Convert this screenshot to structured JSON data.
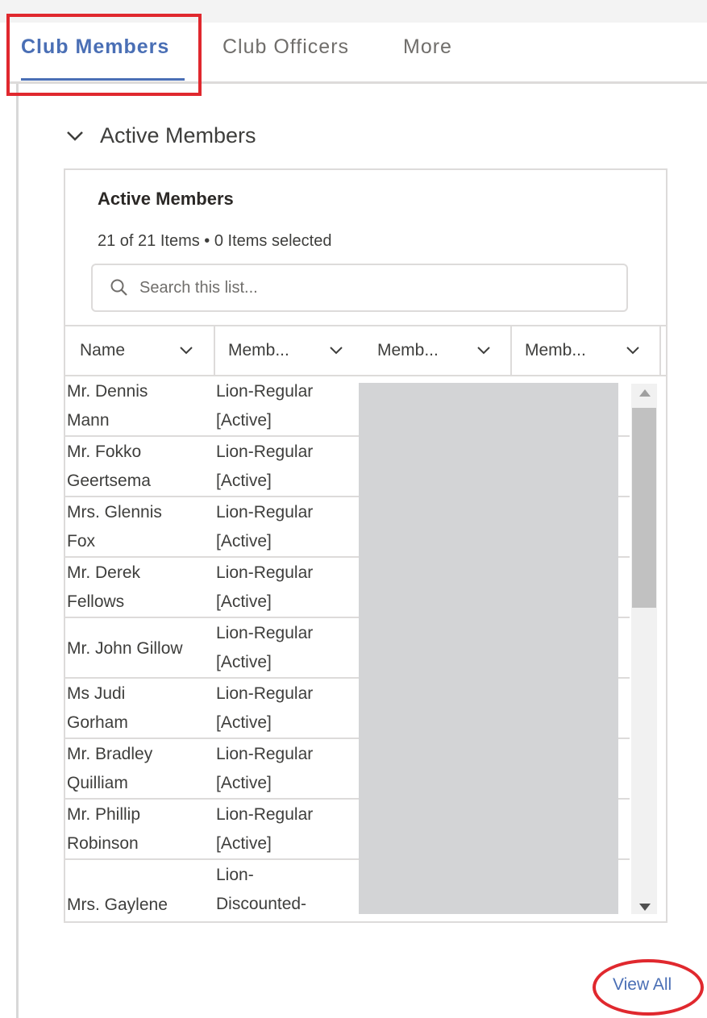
{
  "tabs": [
    {
      "label": "Club Members",
      "active": true
    },
    {
      "label": "Club Officers",
      "active": false
    },
    {
      "label": "More",
      "active": false
    }
  ],
  "section": {
    "title": "Active Members"
  },
  "card": {
    "title": "Active Members",
    "meta": "21 of 21 Items • 0 Items selected",
    "search_placeholder": "Search this list..."
  },
  "columns": [
    "Name",
    "Memb...",
    "Memb...",
    "Memb..."
  ],
  "rows": [
    {
      "name": [
        "Mr. Dennis",
        "Mann"
      ],
      "type": [
        "Lion-Regular",
        "[Active]"
      ]
    },
    {
      "name": [
        "Mr. Fokko",
        "Geertsema"
      ],
      "type": [
        "Lion-Regular",
        "[Active]"
      ]
    },
    {
      "name": [
        "Mrs. Glennis",
        "Fox"
      ],
      "type": [
        "Lion-Regular",
        "[Active]"
      ]
    },
    {
      "name": [
        "Mr. Derek",
        "Fellows"
      ],
      "type": [
        "Lion-Regular",
        "[Active]"
      ]
    },
    {
      "name": [
        "Mr. John Gillow"
      ],
      "type": [
        "Lion-Regular",
        "[Active]"
      ]
    },
    {
      "name": [
        "Ms Judi",
        "Gorham"
      ],
      "type": [
        "Lion-Regular",
        "[Active]"
      ]
    },
    {
      "name": [
        "Mr. Bradley",
        "Quilliam"
      ],
      "type": [
        "Lion-Regular",
        "[Active]"
      ]
    },
    {
      "name": [
        "Mr. Phillip",
        "Robinson"
      ],
      "type": [
        "Lion-Regular",
        "[Active]"
      ]
    },
    {
      "name": [
        "Mrs. Gaylene"
      ],
      "type": [
        "Lion-",
        "Discounted-"
      ]
    }
  ],
  "footer": {
    "view_all": "View All"
  },
  "colors": {
    "accent": "#4a6fb5",
    "highlight": "#e0282e",
    "border": "#dddbda"
  }
}
